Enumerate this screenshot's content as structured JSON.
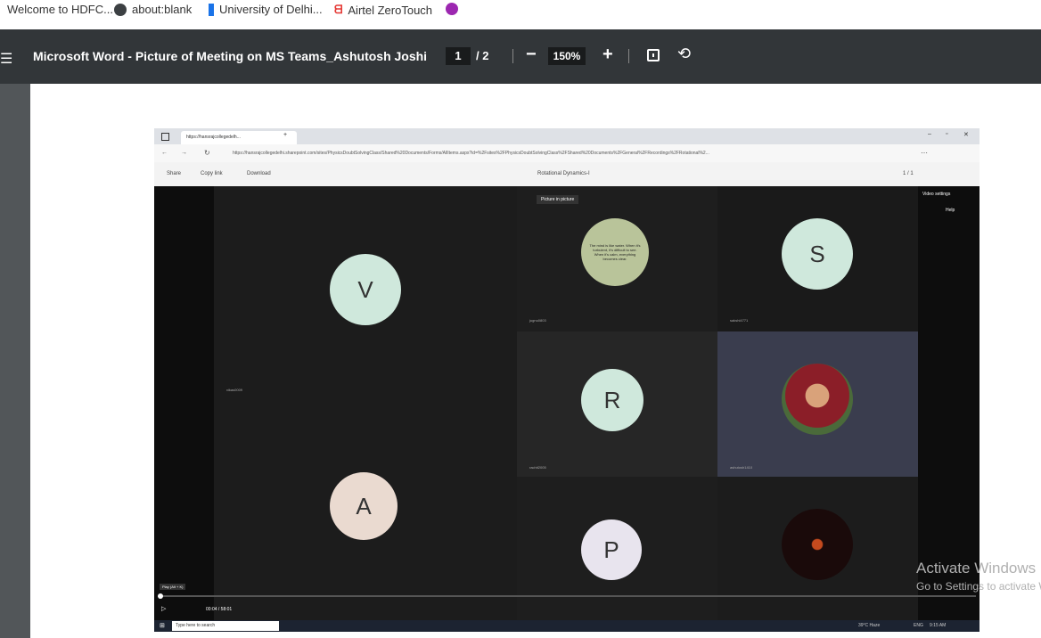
{
  "bookmarks": [
    {
      "label": "Welcome to HDFC...",
      "color": "#d9534f"
    },
    {
      "label": "about:blank",
      "color": "#3c4043"
    },
    {
      "label": "University of Delhi...",
      "color": "#1a73e8"
    },
    {
      "label": "Airtel ZeroTouch",
      "color": "#e53935"
    },
    {
      "label": "",
      "color": "#9c27b0"
    }
  ],
  "pdf_toolbar": {
    "title": "Microsoft Word - Picture of Meeting on MS Teams_Ashutosh Joshi",
    "current_page": "1",
    "page_total": "/ 2",
    "zoom": "150%",
    "zoom_out": "−",
    "zoom_in": "+",
    "fit_icon": "fit-page-icon",
    "rotate_icon": "rotate-icon"
  },
  "embedded": {
    "tab_title": "https://hansrajcollegedelh...",
    "url": "https://hansrajcollegedelhi.sharepoint.com/sites/PhysicsDoubtSolvingClass/Shared%20Documents/Forms/AllItems.aspx?id=%2Fsites%2FPhysicsDoubtSolvingClass%2FShared%20Documents%2FGeneral%2FRecordings%2FRotational%2...",
    "share": "Share",
    "copy_link": "Copy link",
    "download": "Download",
    "file_name": "Rotational Dynamics-I",
    "page_counter": "1 / 1",
    "picture_in_picture": "Picture in picture",
    "video_settings": "Video settings",
    "help": "Help",
    "quote_text": "The mind is like water. When it's turbulent, it's difficult to see. When it's calm, everything becomes clear.",
    "participants": [
      {
        "letter": "V",
        "name": "vikas0009",
        "bg": "#cfe8dc"
      },
      {
        "letter": "",
        "name": "jugnu0803",
        "bg": "#8b9a6a"
      },
      {
        "letter": "S",
        "name": "sakshi4771",
        "bg": "#cfe8dc"
      },
      {
        "letter": "R",
        "name": "rachit2005",
        "bg": "#cfe8dc"
      },
      {
        "letter": "",
        "name": "ashutosh1410",
        "bg": "#5b7a4a"
      },
      {
        "letter": "A",
        "name": "",
        "bg": "#eadad0"
      },
      {
        "letter": "P",
        "name": "",
        "bg": "#e8e4ee"
      },
      {
        "letter": "",
        "name": "",
        "bg": "#1a0a0a"
      }
    ],
    "play_hint": "Play (Alt + K)",
    "time": "00:04 / 58:01",
    "search_placeholder": "Type here to search",
    "tray_weather": "39°C Haze",
    "tray_lang": "ENG",
    "tray_time": "9:15 AM"
  },
  "watermark": {
    "line1": "Activate Windows",
    "line2": "Go to Settings to activate Windows."
  }
}
